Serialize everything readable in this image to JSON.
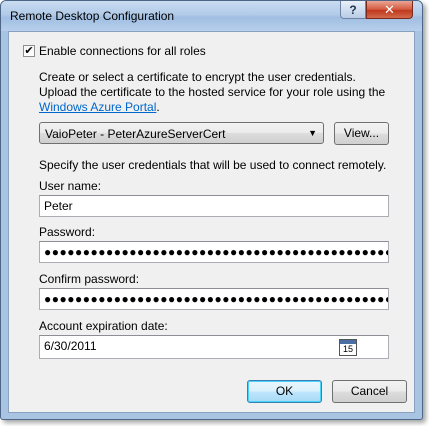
{
  "window": {
    "title": "Remote Desktop Configuration",
    "help_label": "?",
    "close_label": "✕"
  },
  "enable": {
    "checked": true,
    "check_glyph": "✔",
    "label": "Enable connections for all roles"
  },
  "certificate": {
    "instruction_line1": "Create or select a certificate to encrypt the user credentials.",
    "instruction_line2": "Upload the certificate to the hosted service for your role using the",
    "link_text": "Windows Azure Portal",
    "link_suffix": ".",
    "selected": "VaioPeter - PeterAzureServerCert",
    "view_button": "View..."
  },
  "credentials": {
    "instruction": "Specify the user credentials that will be used to connect remotely.",
    "username_label": "User name:",
    "username_value": "Peter",
    "password_label": "Password:",
    "password_mask": "●●●●●●●●●●●●●●●●●●●●●●●●●●●●●●●●●●●●●●●●●●●●●●●●●●●●",
    "confirm_label": "Confirm password:",
    "confirm_mask": "●●●●●●●●●●●●●●●●●●●●●●●●●●●●●●●●●●●●●●●●●●●●●●●●●●●●",
    "expiration_label": "Account expiration date:",
    "expiration_value": "6/30/2011",
    "calendar_day": "15"
  },
  "buttons": {
    "ok": "OK",
    "cancel": "Cancel"
  },
  "colors": {
    "link": "#0066cc",
    "close_button": "#c0381e",
    "default_button_border": "#3c7fb1"
  },
  "icons": {
    "checkbox": "check-mark",
    "dropdown": "chevron-down-icon",
    "calendar": "calendar-icon"
  }
}
